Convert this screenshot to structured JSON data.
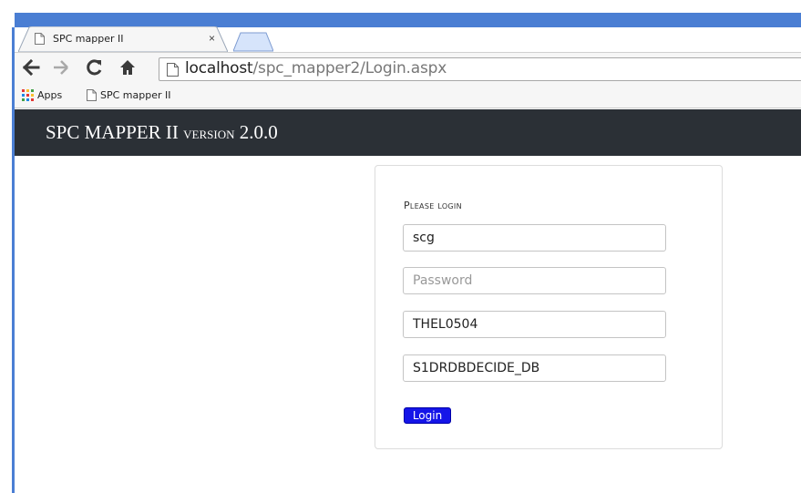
{
  "browser": {
    "tab": {
      "title": "SPC mapper II",
      "close_glyph": "×"
    },
    "url": {
      "host": "localhost",
      "path": "/spc_mapper2/Login.aspx"
    },
    "bookmarks": [
      {
        "label": "Apps",
        "icon": "apps-grid-icon"
      },
      {
        "label": "SPC mapper II",
        "icon": "page-icon"
      }
    ],
    "colors": {
      "frame": "#4a7ed3",
      "toolbar": "#f6f6f6"
    }
  },
  "app": {
    "brand": {
      "name": "SPC MAPPER II",
      "version_word": "version",
      "version_number": "2.0.0"
    },
    "header_color": "#2b3036"
  },
  "login": {
    "title": "Please login",
    "username": {
      "value": "scg"
    },
    "password": {
      "value": "",
      "placeholder": "Password"
    },
    "server": {
      "value": "THEL0504"
    },
    "database": {
      "value": "S1DRDBDECIDE_DB"
    },
    "button_label": "Login",
    "button_color": "#1515e8"
  }
}
